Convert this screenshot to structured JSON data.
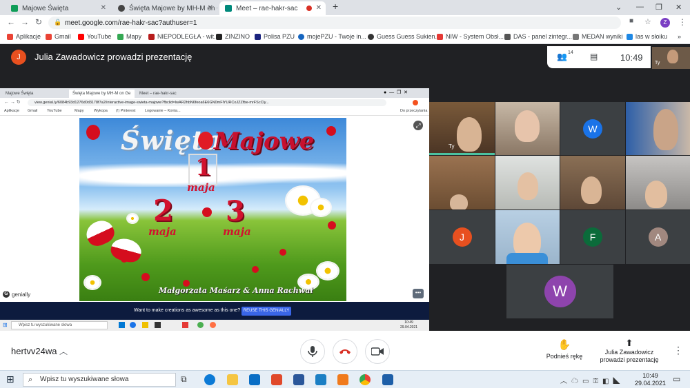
{
  "browser": {
    "tabs": [
      {
        "label": "Majowe Święta",
        "color": "#0f9d58"
      },
      {
        "label": "Święta Majowe by MH-M on Ge",
        "color": "#444"
      },
      {
        "label": "Meet – rae-hakr-sac",
        "color": "#00897b"
      }
    ],
    "url": "meet.google.com/rae-hakr-sac?authuser=1",
    "profile_initial": "Z",
    "bookmarks": [
      {
        "label": "Aplikacje",
        "color": "#ea4335"
      },
      {
        "label": "Gmail",
        "color": "#ea4335"
      },
      {
        "label": "YouTube",
        "color": "#ff0000"
      },
      {
        "label": "Mapy",
        "color": "#34a853"
      },
      {
        "label": "NIEPODLEGŁA - wit...",
        "color": "#b71c1c"
      },
      {
        "label": "ZINZINO",
        "color": "#222"
      },
      {
        "label": "Polisa PZU",
        "color": "#1a237e"
      },
      {
        "label": "mojePZU - Twoje in...",
        "color": "#1565c0"
      },
      {
        "label": "Guess Guess Sukien...",
        "color": "#333"
      },
      {
        "label": "NIW - System Obsł...",
        "color": "#e53935"
      },
      {
        "label": "DAS - panel zintegr...",
        "color": "#555"
      },
      {
        "label": "MEDAN wyniki",
        "color": "#777"
      },
      {
        "label": "las w słoiku",
        "color": "#1e88e5"
      }
    ]
  },
  "meet": {
    "presenter_initial": "J",
    "presenter_title": "Julia Zawadowicz prowadzi prezentację",
    "participant_count": "14",
    "time": "10:49",
    "self_label": "Ty",
    "meeting_code": "hertvv24wa",
    "raise_hand_label": "Podnieś rękę",
    "presenting_label": "Julia Zawadowicz prowadzi prezentację",
    "tiles": [
      {
        "initial": "W",
        "color": "#1a73e8"
      },
      {
        "initial": "J",
        "color": "#e8501f"
      },
      {
        "initial": "F",
        "color": "#0b6b3a"
      },
      {
        "initial": "A",
        "color": "#a1887f"
      },
      {
        "initial": "W",
        "color": "#8e44ad"
      }
    ]
  },
  "shared": {
    "inner_tabs": [
      "Majowe Święta",
      "Święta Majowe by MH-M on Ge",
      "Meet – rae-hakr-sac"
    ],
    "inner_url": "view.genial.ly/6084b93d1276d0d3178f7a2/interactive-image-swieta-majowe?fbclid=IwAR2hbN6feoa6E6GN0mFlYURCoJZZfbe-mrFScCly...",
    "inner_bookmarks": [
      "Aplikacje",
      "Gmail",
      "YouTube",
      "Mapy",
      "Wykopa",
      "(!) Pinterest",
      "Logowanie – Konta...",
      "Do przeczytania"
    ],
    "slide_title_a": "Święta",
    "slide_title_b": "Majowe",
    "dates": [
      {
        "num": "1",
        "label": "maja"
      },
      {
        "num": "2",
        "label": "maja"
      },
      {
        "num": "3",
        "label": "maja"
      }
    ],
    "credit": "Małgorzata Maśarz & Anna Rachwał",
    "brand": "genially",
    "promo_text": "Want to make creations as awesome as this one?",
    "promo_button": "REUSE THIS GENIALLY",
    "inner_search": "Wpisz tu wyszukiwane słowa",
    "inner_time": "10:49",
    "inner_date": "29.04.2021"
  },
  "taskbar": {
    "search_placeholder": "Wpisz tu wyszukiwane słowa",
    "time": "10:49",
    "date": "29.04.2021"
  }
}
